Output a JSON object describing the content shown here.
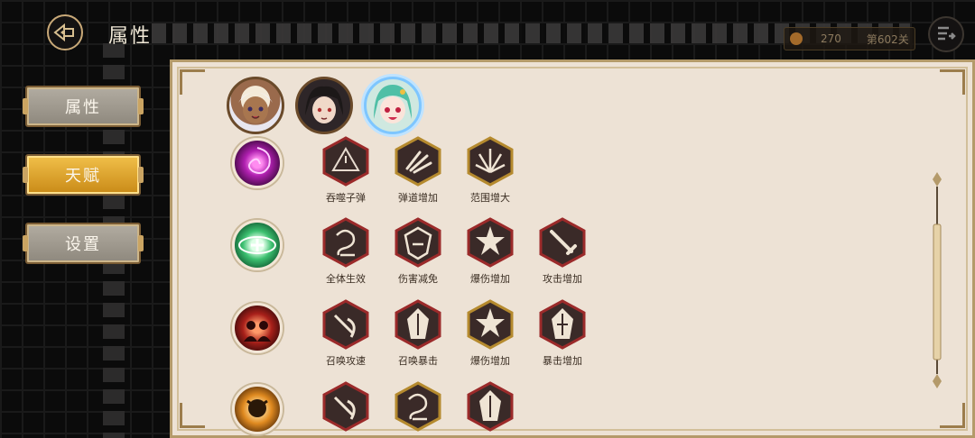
{
  "header": {
    "title": "属性",
    "resource_value": "270",
    "stage_label": "第602关"
  },
  "sidebar": {
    "items": [
      {
        "label": "属性",
        "active": false
      },
      {
        "label": "天赋",
        "active": true
      },
      {
        "label": "设置",
        "active": false
      }
    ]
  },
  "characters": [
    {
      "name": "white-haired-character",
      "selected": false
    },
    {
      "name": "dark-haired-character",
      "selected": false
    },
    {
      "name": "green-haired-character",
      "selected": true
    }
  ],
  "talent_rows": [
    {
      "class_icon": "purple-vortex-icon",
      "skills": [
        {
          "label": "吞噬子弹",
          "frame": "red"
        },
        {
          "label": "弹道增加",
          "frame": "gold"
        },
        {
          "label": "范围增大",
          "frame": "gold"
        }
      ]
    },
    {
      "class_icon": "green-shield-icon",
      "skills": [
        {
          "label": "全体生效",
          "frame": "red"
        },
        {
          "label": "伤害减免",
          "frame": "red"
        },
        {
          "label": "爆伤增加",
          "frame": "red"
        },
        {
          "label": "攻击增加",
          "frame": "red"
        }
      ]
    },
    {
      "class_icon": "red-summon-icon",
      "skills": [
        {
          "label": "召唤攻速",
          "frame": "red"
        },
        {
          "label": "召唤暴击",
          "frame": "red"
        },
        {
          "label": "爆伤增加",
          "frame": "gold"
        },
        {
          "label": "暴击增加",
          "frame": "red"
        }
      ]
    },
    {
      "class_icon": "gold-demon-icon",
      "skills": [
        {
          "label": "",
          "frame": "red"
        },
        {
          "label": "",
          "frame": "gold"
        },
        {
          "label": "",
          "frame": "red"
        }
      ]
    }
  ],
  "colors": {
    "red_frame": "#9b2a2a",
    "gold_frame": "#b58a2e",
    "panel_bg": "#ede2d5",
    "active_tab": "#e2a92c"
  }
}
